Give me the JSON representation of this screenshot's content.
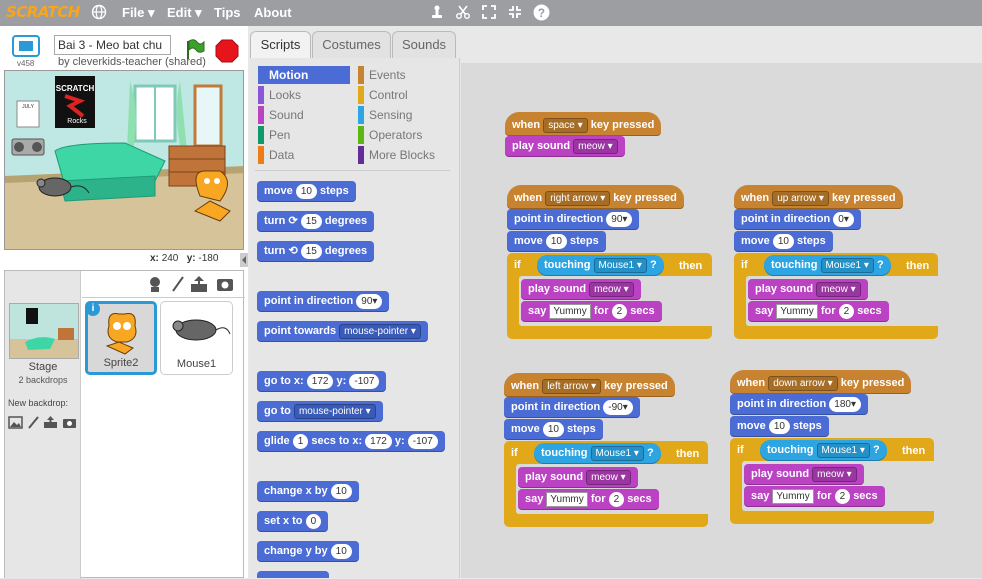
{
  "menu": {
    "logo": "SCRATCH",
    "file": "File ▾",
    "edit": "Edit ▾",
    "tips": "Tips",
    "about": "About"
  },
  "toolbar_icons": [
    "duplicate-icon",
    "delete-scissors-icon",
    "grow-icon",
    "shrink-icon",
    "help-icon"
  ],
  "project": {
    "title": "Bai 3 - Meo bat chu",
    "author": "by cleverkids-teacher (shared)",
    "version": "v458"
  },
  "stage": {
    "coords_x_label": "x:",
    "coords_x": "240",
    "coords_y_label": "y:",
    "coords_y": "-180",
    "poster_text": "SCRATCH Rocks",
    "calendar": "JULY"
  },
  "sprites": {
    "stage_label": "Stage",
    "stage_sub": "2 backdrops",
    "new_backdrop": "New backdrop:",
    "items": [
      "Sprite2",
      "Mouse1"
    ]
  },
  "tabs": [
    "Scripts",
    "Costumes",
    "Sounds"
  ],
  "categories": [
    {
      "name": "Motion",
      "color": "#4a6cd4"
    },
    {
      "name": "Events",
      "color": "#c88330"
    },
    {
      "name": "Looks",
      "color": "#8a55d7"
    },
    {
      "name": "Control",
      "color": "#e1a91a"
    },
    {
      "name": "Sound",
      "color": "#bb42c3"
    },
    {
      "name": "Sensing",
      "color": "#2ca5e2"
    },
    {
      "name": "Pen",
      "color": "#0e9a6c"
    },
    {
      "name": "Operators",
      "color": "#5cb712"
    },
    {
      "name": "Data",
      "color": "#ee7d16"
    },
    {
      "name": "More Blocks",
      "color": "#632d99"
    }
  ],
  "palette": {
    "move": "move",
    "move_n": "10",
    "steps": "steps",
    "turn": "turn",
    "turn_n": "15",
    "degrees": "degrees",
    "point_dir": "point in direction",
    "point_dir_n": "90▾",
    "point_towards": "point towards",
    "towards_val": "mouse-pointer ▾",
    "goto": "go to x:",
    "goto_x": "172",
    "y_lbl": "y:",
    "goto_y": "-107",
    "goto_sprite": "go to",
    "goto_sprite_val": "mouse-pointer ▾",
    "glide": "glide",
    "glide_n": "1",
    "secs_to_x": "secs to x:",
    "glide_x": "172",
    "glide_y": "-107",
    "change_x": "change x by",
    "change_x_n": "10",
    "set_x": "set x to",
    "set_x_n": "0",
    "change_y": "change y by",
    "change_y_n": "10"
  },
  "scripts": {
    "when": "when",
    "key_pressed": "key pressed",
    "play_sound": "play sound",
    "meow": "meow ▾",
    "point_dir": "point in direction",
    "move": "move",
    "steps": "steps",
    "if": "if",
    "touching": "touching",
    "mouse1": "Mouse1 ▾",
    "q": "?",
    "then": "then",
    "say": "say",
    "yummy": "Yummy",
    "for": "for",
    "secs": "secs",
    "ten": "10",
    "two": "2",
    "space": "space ▾",
    "right": "right arrow ▾",
    "dir_right": "90▾",
    "up": "up arrow ▾",
    "dir_up": "0▾",
    "left": "left arrow ▾",
    "dir_left": "-90▾",
    "down": "down arrow ▾",
    "dir_down": "180▾"
  }
}
